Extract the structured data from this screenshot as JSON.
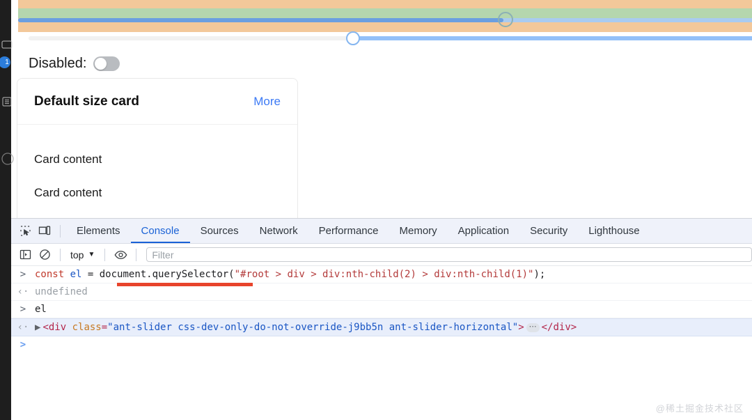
{
  "activity_bar": {
    "badge_count": "1",
    "icons": [
      "window-icon",
      "list-icon",
      "circle-icon"
    ]
  },
  "page": {
    "slider_highlighted": {
      "name": "ant-slider-horizontal",
      "value_percent": 64,
      "handle_label": "slider-handle"
    },
    "slider_plain": {
      "value_percent": 44,
      "handle_label": "slider-handle"
    },
    "disabled_row": {
      "label": "Disabled:",
      "switch_state": "off"
    },
    "card": {
      "title": "Default size card",
      "action_label": "More",
      "lines": [
        "Card content",
        "Card content"
      ]
    }
  },
  "devtools": {
    "toolbar_icons": [
      "inspect-element-icon",
      "device-toolbar-icon"
    ],
    "tabs": [
      {
        "label": "Elements",
        "active": false
      },
      {
        "label": "Console",
        "active": true
      },
      {
        "label": "Sources",
        "active": false
      },
      {
        "label": "Network",
        "active": false
      },
      {
        "label": "Performance",
        "active": false
      },
      {
        "label": "Memory",
        "active": false
      },
      {
        "label": "Application",
        "active": false
      },
      {
        "label": "Security",
        "active": false
      },
      {
        "label": "Lighthouse",
        "active": false
      }
    ],
    "filter_bar": {
      "sidebar_toggle_icon": "console-sidebar-icon",
      "clear_icon": "clear-console-icon",
      "context_label": "top",
      "context_caret": "▼",
      "eye_icon": "live-expression-icon",
      "filter_placeholder": "Filter",
      "filter_value": ""
    },
    "console_rows": [
      {
        "kind": "input",
        "gutter": ">",
        "tokens": [
          {
            "t": "const",
            "c": "kw"
          },
          {
            "t": " ",
            "c": "plain"
          },
          {
            "t": "el",
            "c": "var"
          },
          {
            "t": " = ",
            "c": "plain"
          },
          {
            "t": "document.querySelector(",
            "c": "plain"
          },
          {
            "t": "\"#root > div > div:nth-child(2) > div:nth-child(1)\"",
            "c": "str"
          },
          {
            "t": ");",
            "c": "plain"
          }
        ],
        "has_red_underline": true
      },
      {
        "kind": "result",
        "gutter": "‹·",
        "tokens": [
          {
            "t": "undefined",
            "c": "undef"
          }
        ]
      },
      {
        "kind": "input",
        "gutter": ">",
        "tokens": [
          {
            "t": "el",
            "c": "plain"
          }
        ]
      },
      {
        "kind": "selected",
        "gutter": "‹·",
        "triangle": "▶",
        "tokens": [
          {
            "t": "<div",
            "c": "tag"
          },
          {
            "t": " class",
            "c": "attr"
          },
          {
            "t": "=",
            "c": "tag"
          },
          {
            "t": "\"ant-slider css-dev-only-do-not-override-j9bb5n ant-slider-horizontal\"",
            "c": "val"
          },
          {
            "t": ">",
            "c": "tag"
          }
        ],
        "ellipsis_badge": "⋯",
        "tail_tokens": [
          {
            "t": "</div>",
            "c": "tag"
          }
        ]
      },
      {
        "kind": "prompt",
        "gutter": ">",
        "tokens": []
      }
    ]
  },
  "watermark": "@稀土掘金技术社区"
}
